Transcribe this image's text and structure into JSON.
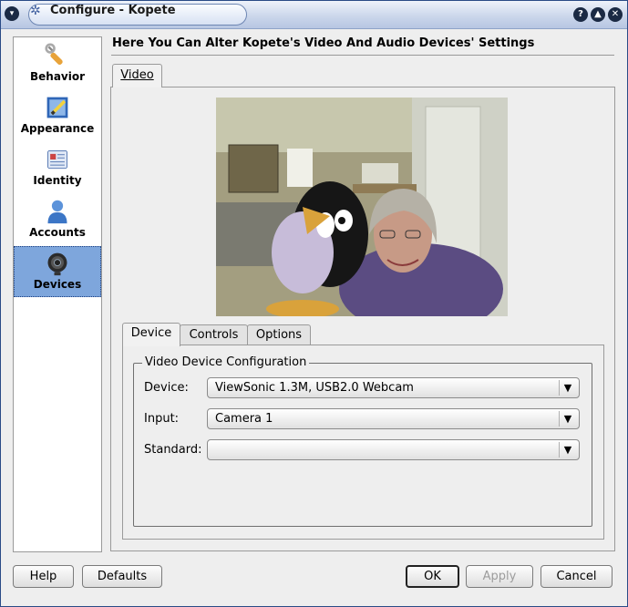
{
  "window": {
    "title": "Configure - Kopete",
    "titlebar_buttons": [
      "?",
      "▲",
      "✕"
    ]
  },
  "sidebar": {
    "items": [
      {
        "label": "Behavior",
        "icon": "wrench-icon"
      },
      {
        "label": "Appearance",
        "icon": "paint-brush-icon"
      },
      {
        "label": "Identity",
        "icon": "id-card-icon"
      },
      {
        "label": "Accounts",
        "icon": "user-icon"
      },
      {
        "label": "Devices",
        "icon": "webcam-icon",
        "selected": true
      }
    ]
  },
  "page": {
    "title": "Here You Can Alter Kopete's Video And Audio Devices' Settings",
    "outer_tab": "Video"
  },
  "inner_tabs": [
    "Device",
    "Controls",
    "Options"
  ],
  "group": {
    "title": "Video Device Configuration",
    "fields": [
      {
        "label": "Device:",
        "value": "ViewSonic 1.3M, USB2.0 Webcam"
      },
      {
        "label": "Input:",
        "value": "Camera 1"
      },
      {
        "label": "Standard:",
        "value": ""
      }
    ]
  },
  "buttons": {
    "help": "Help",
    "defaults": "Defaults",
    "ok": "OK",
    "apply": "Apply",
    "cancel": "Cancel"
  },
  "colors": {
    "selection": "#7ea6dc",
    "titlebar": "#c9d5ea"
  }
}
